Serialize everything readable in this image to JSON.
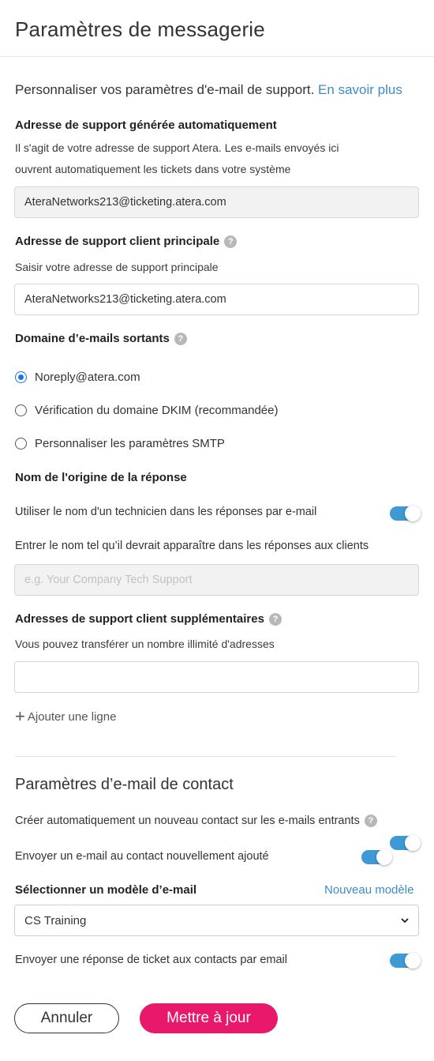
{
  "header": {
    "title": "Paramètres de messagerie"
  },
  "intro": {
    "text": "Personnaliser vos paramètres d'e-mail de support.",
    "link": "En savoir plus"
  },
  "auto_address": {
    "label": "Adresse de support générée automatiquement",
    "desc_line1": "Il s'agit de votre adresse de support Atera. Les e-mails envoyés ici",
    "desc_line2": "ouvrent automatiquement les tickets dans votre système",
    "value": "AteraNetworks213@ticketing.atera.com"
  },
  "main_address": {
    "label": "Adresse de support client principale",
    "desc": "Saisir votre adresse de support principale",
    "value": "AteraNetworks213@ticketing.atera.com"
  },
  "outgoing": {
    "label": "Domaine d’e-mails sortants",
    "options": [
      {
        "label": "Noreply@atera.com",
        "checked": true
      },
      {
        "label": "Vérification du domaine DKIM (recommandée)",
        "checked": false
      },
      {
        "label": "Personnaliser les paramètres SMTP",
        "checked": false
      }
    ]
  },
  "reply_origin": {
    "label": "Nom de l'origine de la réponse",
    "toggle_label": "Utiliser le nom d'un technicien dans les réponses par e-mail",
    "toggle_on": true,
    "name_desc": "Entrer le nom tel qu’il devrait apparaître dans les réponses aux clients",
    "name_placeholder": "e.g. Your Company Tech Support"
  },
  "additional": {
    "label": "Adresses de support client supplémentaires",
    "desc": "Vous pouvez transférer un nombre illimité d'adresses",
    "value": "",
    "add_line": "Ajouter une ligne"
  },
  "contact": {
    "title": "Paramètres d’e-mail de contact",
    "auto_create": "Créer automatiquement un nouveau contact sur les e-mails entrants",
    "auto_create_on": true,
    "send_email": "Envoyer un e-mail au contact nouvellement ajouté",
    "send_email_on": true,
    "template_label": "Sélectionner un modèle d’e-mail",
    "new_template": "Nouveau modèle",
    "template_value": "CS Training",
    "ticket_reply": "Envoyer une réponse de ticket aux contacts par email",
    "ticket_reply_on": true
  },
  "actions": {
    "cancel": "Annuler",
    "update": "Mettre à jour"
  },
  "colors": {
    "accent": "#3d9ad5",
    "primary_button": "#e8186b",
    "link": "#3d8bcb"
  },
  "icons": {
    "help": "help-icon",
    "plus": "plus-icon",
    "chevron": "chevron-down-icon"
  }
}
